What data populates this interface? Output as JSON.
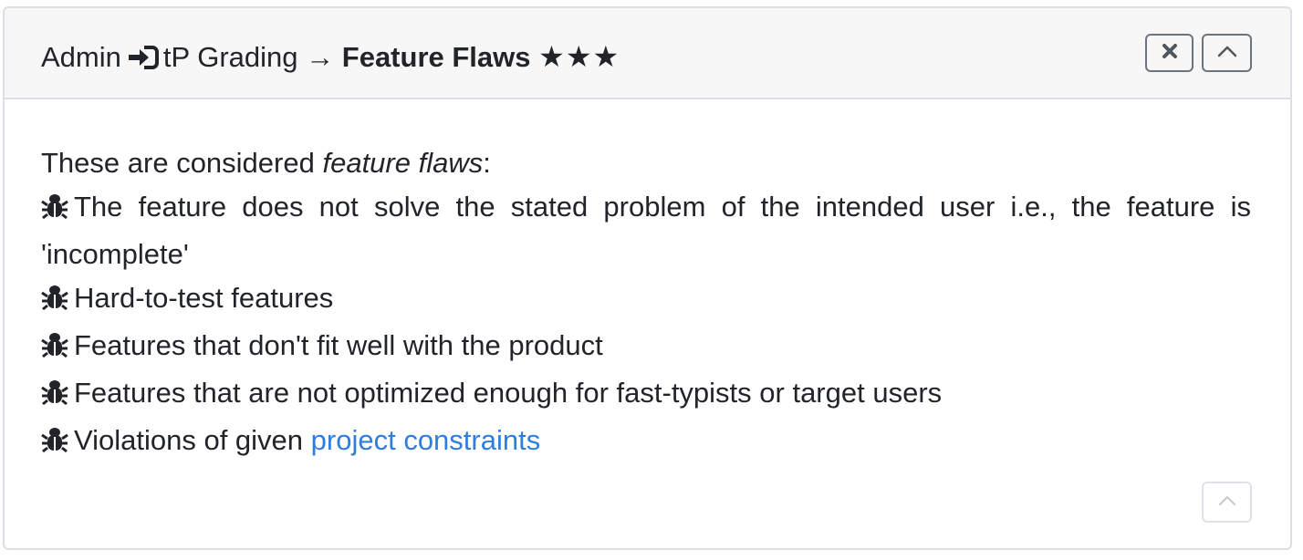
{
  "header": {
    "crumb_admin": "Admin",
    "crumb_icon": "sign-in-icon",
    "crumb_grading": "tP Grading",
    "arrow": "→",
    "current": "Feature Flaws",
    "stars": "★★★"
  },
  "controls": {
    "close_icon": "close-icon",
    "collapse_icon": "chevron-up-icon"
  },
  "body": {
    "intro_prefix": "These are considered ",
    "intro_emphasis": "feature flaws",
    "intro_suffix": ":",
    "bullet_icon": "bug-icon",
    "items": [
      "The feature does not solve the stated problem of the intended user i.e., the feature is",
      "'incomplete'",
      "Hard-to-test features",
      "Features that don't fit well with the product",
      "Features that are not optimized enough for fast-typists or target users"
    ],
    "last_item_prefix": "Violations of given ",
    "last_item_link": "project constraints"
  },
  "colors": {
    "link": "#2f7de1",
    "header_bg": "#f7f7f8",
    "border": "#dcdfe3",
    "text": "#212529"
  }
}
